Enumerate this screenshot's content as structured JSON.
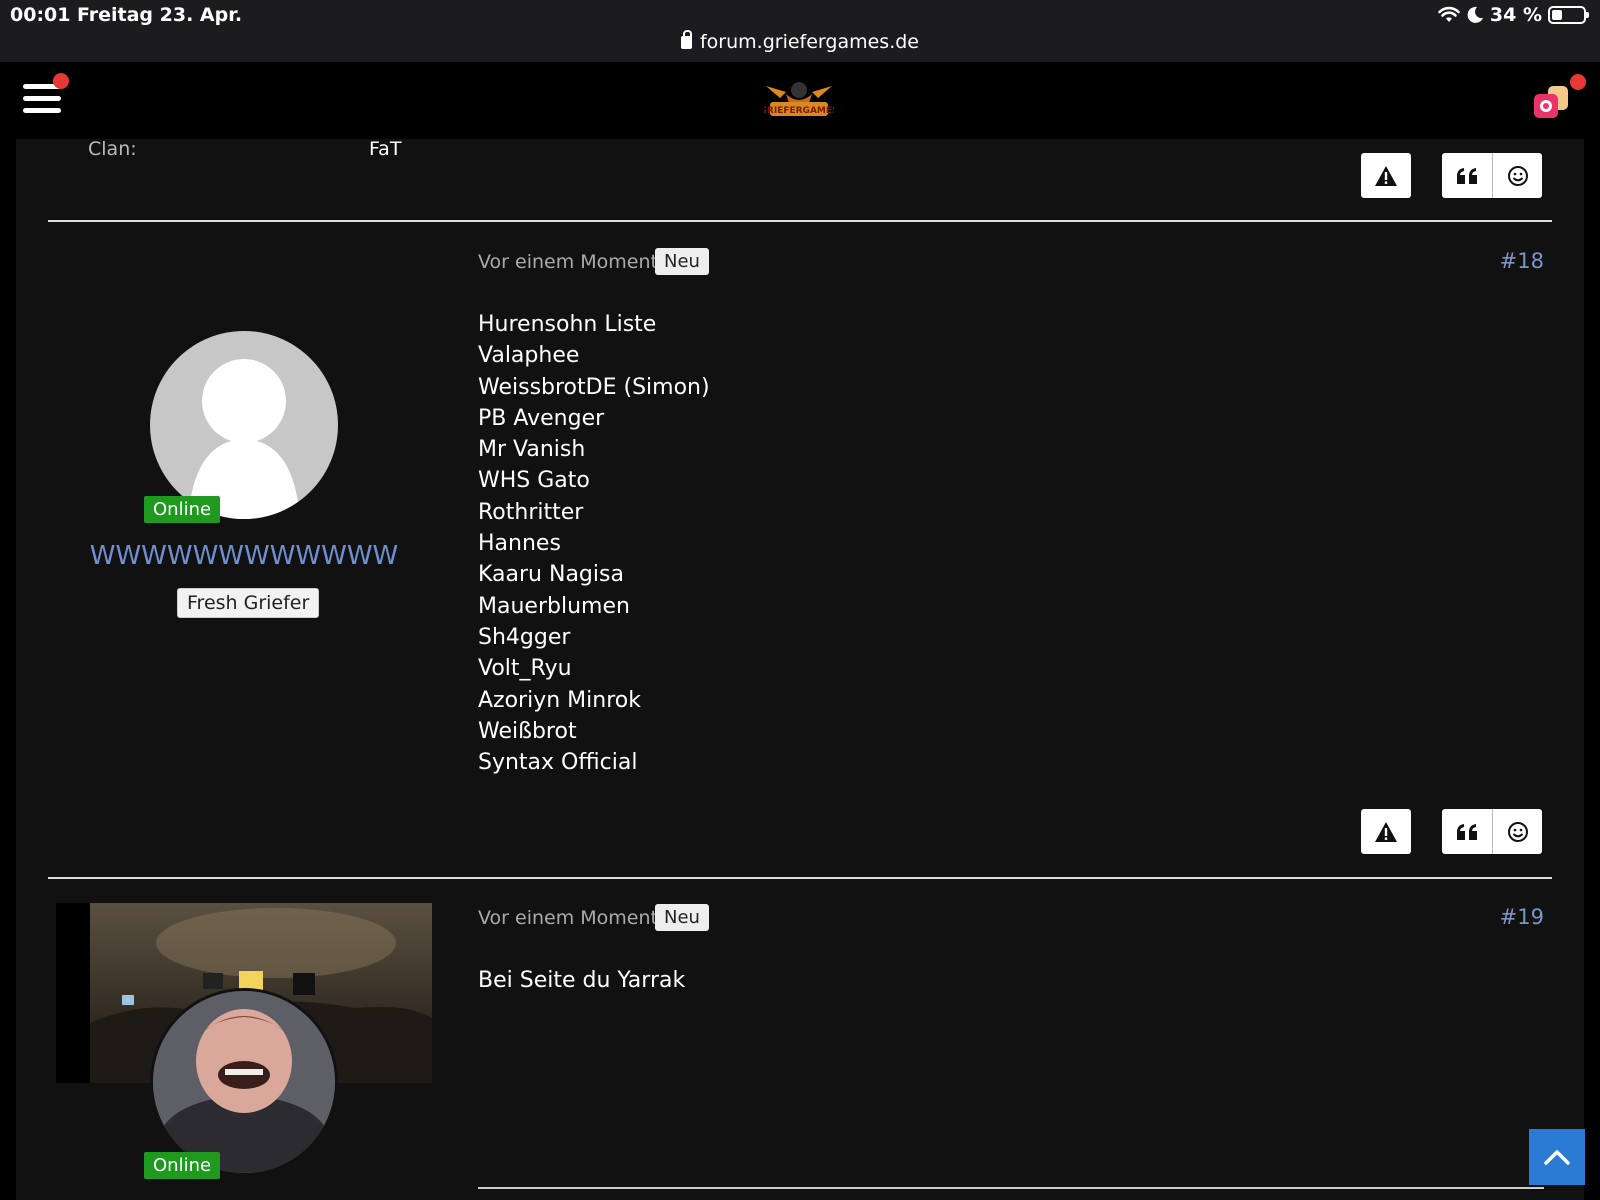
{
  "status_bar": {
    "time": "00:01",
    "date": "Freitag 23. Apr.",
    "battery": "34 %",
    "url": "forum.griefergames.de"
  },
  "header": {
    "logo_icon": "griefergames-logo",
    "menu_icon": "hamburger-menu-icon",
    "cart_icon": "shop-icon",
    "notification_color": "#e53935"
  },
  "previous_post": {
    "clan_label": "Clan:",
    "clan_value": "FaT"
  },
  "posts": [
    {
      "time": "Vor einem Moment",
      "badge": "Neu",
      "number": "#18",
      "author": {
        "status": "Online",
        "name": "WWWWWWWWWWWW",
        "rank": "Fresh Griefer"
      },
      "lines": [
        "Hurensohn Liste",
        "Valaphee",
        "WeissbrotDE (Simon)",
        "PB Avenger",
        "Mr Vanish",
        "WHS Gato",
        "Rothritter",
        "Hannes",
        "Kaaru Nagisa",
        "Mauerblumen",
        "Sh4gger",
        "Volt_Ryu",
        "Azoriyn Minrok",
        "Weißbrot",
        "Syntax Official"
      ]
    },
    {
      "time": "Vor einem Moment",
      "badge": "Neu",
      "number": "#19",
      "author": {
        "status": "Online"
      },
      "lines": [
        "Bei Seite du Yarrak"
      ]
    }
  ],
  "colors": {
    "link": "#7b97c8",
    "online": "#1f9a1f",
    "scroll_top": "#2a7bd4"
  }
}
